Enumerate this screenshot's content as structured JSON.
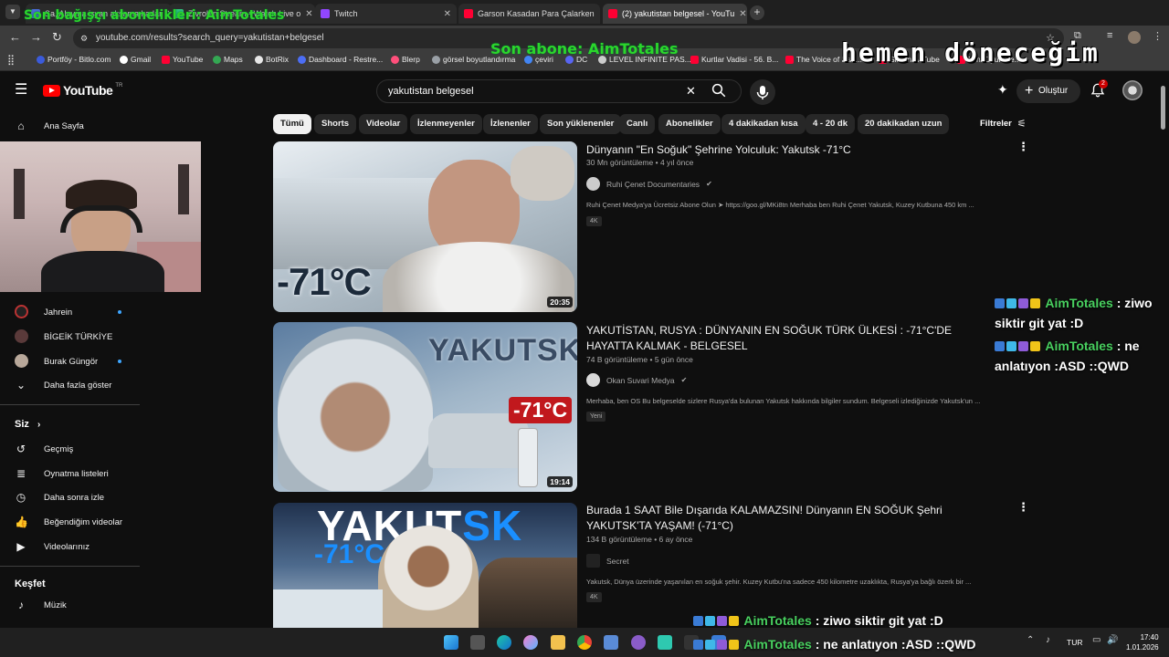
{
  "browser": {
    "tabs": [
      {
        "label": "Sa, Alayına isyan akşama kadar",
        "color": "#4a6cd9"
      },
      {
        "label": "Zivrobin Stream - Watch Live o",
        "color": "#2ec27e"
      },
      {
        "label": "Twitch",
        "color": "#9146ff"
      },
      {
        "label": "Garson Kasadan Para Çalarken",
        "color": "#ff0033"
      },
      {
        "label": "(2) yakutistan belgesel - YouTu",
        "color": "#ff0033"
      }
    ],
    "url": "youtube.com/results?search_query=yakutistan+belgesel",
    "bookmarks": [
      {
        "label": "Portföy - Bitlo.com",
        "color": "#3b5bdb"
      },
      {
        "label": "Gmail",
        "color": "#ffffff"
      },
      {
        "label": "YouTube",
        "color": "#ff0033"
      },
      {
        "label": "Maps",
        "color": "#34a853"
      },
      {
        "label": "BotRix",
        "color": "#e8e8e8"
      },
      {
        "label": "Dashboard - Restre...",
        "color": "#4c6ef5"
      },
      {
        "label": "Blerp",
        "color": "#ff4f7b"
      },
      {
        "label": "görsel boyutlandırma",
        "color": "#9aa0a6"
      },
      {
        "label": "çeviri",
        "color": "#4285f4"
      },
      {
        "label": "DC",
        "color": "#5865f2"
      },
      {
        "label": "LEVEL INFINITE PAS...",
        "color": "#cccccc"
      },
      {
        "label": "Kurtlar Vadisi - 56. B...",
        "color": "#ff0033"
      },
      {
        "label": "The Voice of Batt...",
        "color": "#ff0033"
      },
      {
        "label": "Sinema / Tube",
        "color": "#ff0033"
      },
      {
        "label": "Mini Oyun Ve...",
        "color": "#ff0033"
      }
    ]
  },
  "youtube": {
    "logo": "YouTube",
    "logo_sup": "TR",
    "search_query": "yakutistan belgesel",
    "create_label": "Oluştur",
    "notification_count": "2",
    "chips": [
      "Tümü",
      "Shorts",
      "Videolar",
      "İzlenmeyenler",
      "İzlenenler",
      "Son yüklenenler",
      "Canlı",
      "Abonelikler",
      "4 dakikadan kısa",
      "4 - 20 dk",
      "20 dakikadan uzun"
    ],
    "filters_label": "Filtreler",
    "sidebar": {
      "home": "Ana Sayfa",
      "subscriptions": [
        "Jahrein",
        "BİGEİK TÜRKİYE",
        "Burak Güngör"
      ],
      "show_more": "Daha fazla göster",
      "you_header": "Siz",
      "you_items": [
        "Geçmiş",
        "Oynatma listeleri",
        "Daha sonra izle",
        "Beğendiğim videolar",
        "Videolarınız"
      ],
      "explore_header": "Keşfet",
      "explore_items": [
        "Müzik"
      ]
    },
    "results": [
      {
        "title": "Dünyanın \"En Soğuk\" Şehrine Yolculuk: Yakutsk -71°C",
        "views": "30 Mn görüntüleme",
        "age": "4 yıl önce",
        "channel": "Ruhi Çenet Documentaries",
        "description": "Ruhi Çenet Medya'ya Ücretsiz Abone Olun ➤ https://goo.gl/MKi8tn Merhaba ben Ruhi Çenet Yakutsk, Kuzey Kutbuna 450 km ...",
        "badge": "4K",
        "duration": "20:35",
        "thumb_text": "-71°C"
      },
      {
        "title": "YAKUTİSTAN, RUSYA : DÜNYANIN EN SOĞUK TÜRK ÜLKESİ : -71°C'DE HAYATTA KALMAK - BELGESEL",
        "views": "74 B görüntüleme",
        "age": "5 gün önce",
        "channel": "Okan Suvari Medya",
        "description": "Merhaba, ben OS Bu belgeselde sizlere Rusya'da bulunan Yakutsk hakkında bilgiler sundum. Belgeseli izlediğinizde Yakutsk'un ...",
        "badge": "Yeni",
        "duration": "19:14",
        "thumb_text": "YAKUTSK",
        "thumb_sign": "-71°C"
      },
      {
        "title": "Burada 1 SAAT Bile Dışarıda KALAMAZSIN! Dünyanın EN SOĞUK Şehri YAKUTSK'TA YAŞAM! (-71°C)",
        "views": "134 B görüntüleme",
        "age": "6 ay önce",
        "channel": "Secret",
        "description": "Yakutsk, Dünya üzerinde yaşanılan en soğuk şehir. Kuzey Kutbu'na sadece 450 kilometre uzaklıkta, Rusya'ya bağlı özerk bir ...",
        "badge": "4K",
        "thumb_text_a": "YAKUT",
        "thumb_text_b": "SK",
        "thumb_text_c": "-71°C"
      }
    ]
  },
  "stream_overlay": {
    "top_left": "Son bağışçı abonelikleri: AimTotales",
    "last_sub": "Son abone: AimTotales",
    "brb": "hemen döneceğim",
    "chat": [
      {
        "name": "AimTotales",
        "message": " : ziwo siktir git yat :D"
      },
      {
        "name": "AimTotales",
        "message": " : ne anlatıyon :ASD ::QWD"
      }
    ],
    "chat_bottom": [
      {
        "name": "AimTotales",
        "message": " : ziwo siktir git yat :D"
      },
      {
        "name": "AimTotales",
        "message": " : ne anlatıyon :ASD ::QWD"
      }
    ]
  },
  "taskbar": {
    "lang": "TUR",
    "time": "17:40",
    "date": "1.01.2026"
  }
}
